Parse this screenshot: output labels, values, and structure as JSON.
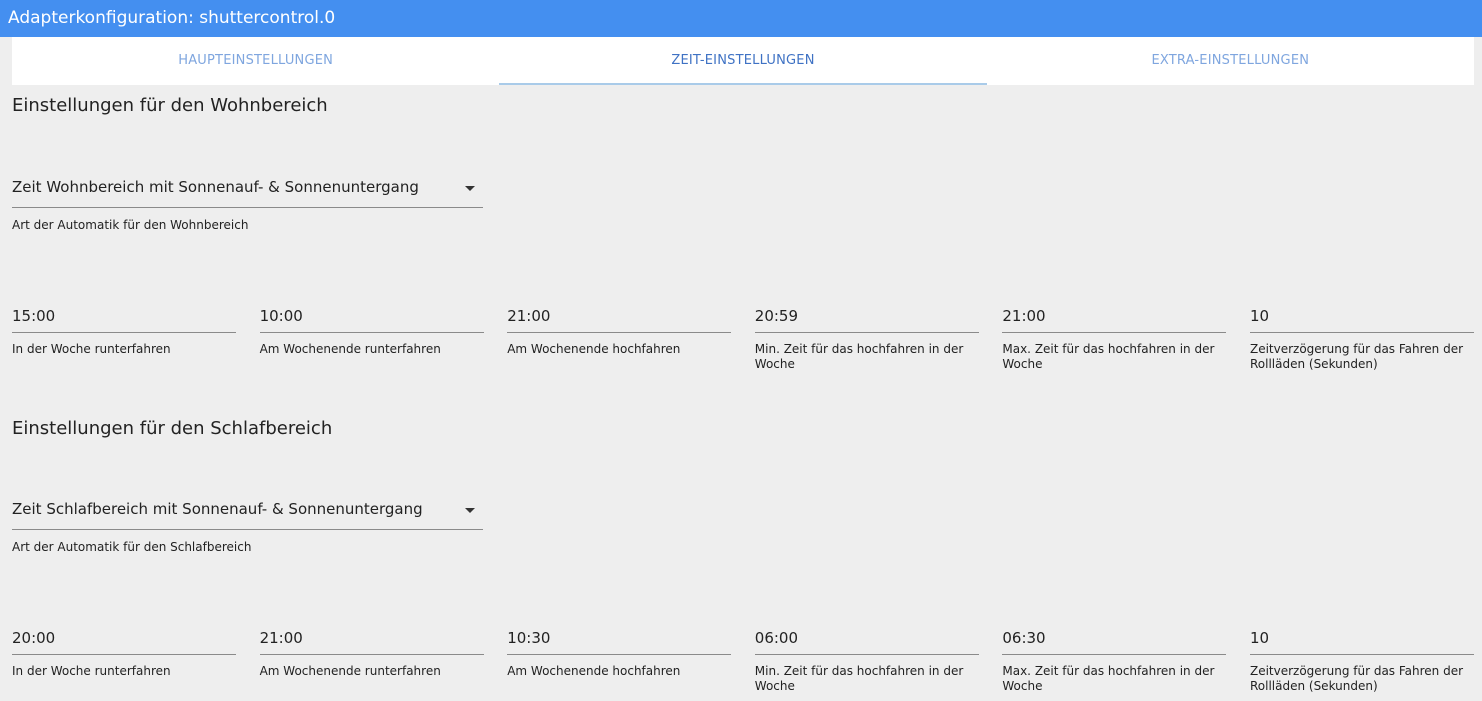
{
  "window": {
    "title": "Adapterkonfiguration: shuttercontrol.0"
  },
  "tabs": [
    {
      "label": "HAUPTEINSTELLUNGEN",
      "active": false
    },
    {
      "label": "ZEIT-EINSTELLUNGEN",
      "active": true
    },
    {
      "label": "EXTRA-EINSTELLUNGEN",
      "active": false
    }
  ],
  "sections": [
    {
      "title": "Einstellungen für den Wohnbereich",
      "select": {
        "value": "Zeit Wohnbereich mit Sonnenauf- & Sonnenuntergang",
        "helper": "Art der Automatik für den Wohnbereich"
      },
      "fields": [
        {
          "value": "15:00",
          "label": "In der Woche runterfahren"
        },
        {
          "value": "10:00",
          "label": "Am Wochenende runterfahren"
        },
        {
          "value": "21:00",
          "label": "Am Wochenende hochfahren"
        },
        {
          "value": "20:59",
          "label": "Min. Zeit für das hochfahren in der Woche"
        },
        {
          "value": "21:00",
          "label": "Max. Zeit für das hochfahren in der Woche"
        },
        {
          "value": "10",
          "label": "Zeitverzögerung für das Fahren der Rollläden (Sekunden)"
        }
      ]
    },
    {
      "title": "Einstellungen für den Schlafbereich",
      "select": {
        "value": "Zeit Schlafbereich mit Sonnenauf- & Sonnenuntergang",
        "helper": "Art der Automatik für den Schlafbereich"
      },
      "fields": [
        {
          "value": "20:00",
          "label": "In der Woche runterfahren"
        },
        {
          "value": "21:00",
          "label": "Am Wochenende runterfahren"
        },
        {
          "value": "10:30",
          "label": "Am Wochenende hochfahren"
        },
        {
          "value": "06:00",
          "label": "Min. Zeit für das hochfahren in der Woche"
        },
        {
          "value": "06:30",
          "label": "Max. Zeit für das hochfahren in der Woche"
        },
        {
          "value": "10",
          "label": "Zeitverzögerung für das Fahren der Rollläden (Sekunden)"
        }
      ]
    }
  ],
  "colors": {
    "titlebar": "#448ff0",
    "tab_text": "#7fa6df",
    "tab_active_text": "#3f72c4",
    "tab_indicator": "#a9cbe9",
    "background": "#eeeeee"
  },
  "icons": {
    "select_caret": "caret-down-icon"
  }
}
